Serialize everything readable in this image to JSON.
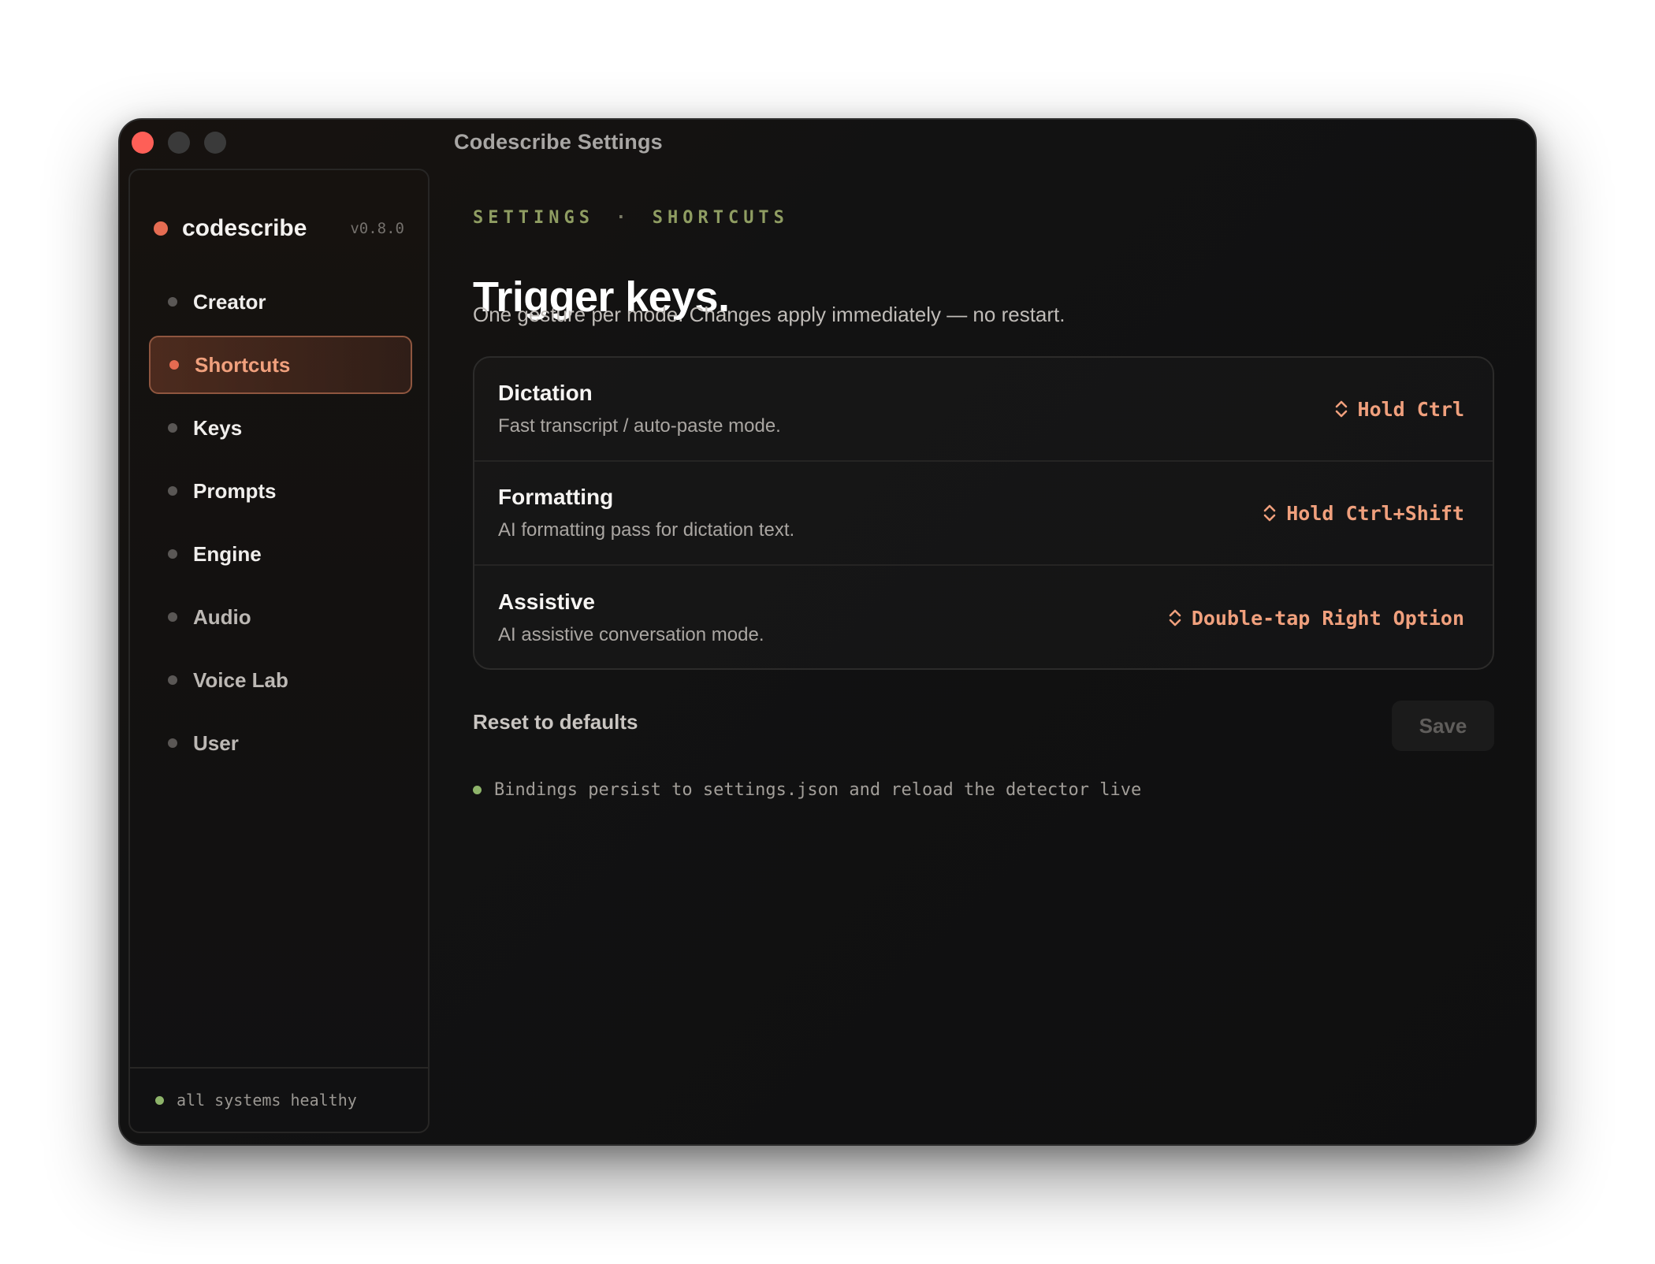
{
  "window": {
    "title": "Codescribe Settings"
  },
  "sidebar": {
    "brand": {
      "name": "codescribe",
      "version": "v0.8.0"
    },
    "items": [
      {
        "label": "Creator"
      },
      {
        "label": "Shortcuts",
        "active": true
      },
      {
        "label": "Keys"
      },
      {
        "label": "Prompts"
      },
      {
        "label": "Engine"
      },
      {
        "label": "Audio"
      },
      {
        "label": "Voice Lab"
      },
      {
        "label": "User"
      }
    ],
    "footer_status": "all systems healthy"
  },
  "main": {
    "breadcrumb": {
      "section": "SETTINGS",
      "separator": "·",
      "page": "SHORTCUTS"
    },
    "title": "Trigger keys.",
    "subtitle": "One gesture per mode. Changes apply immediately — no restart.",
    "bindings": [
      {
        "name": "Dictation",
        "description": "Fast transcript / auto-paste mode.",
        "shortcut": "Hold Ctrl"
      },
      {
        "name": "Formatting",
        "description": "AI formatting pass for dictation text.",
        "shortcut": "Hold Ctrl+Shift"
      },
      {
        "name": "Assistive",
        "description": "AI assistive conversation mode.",
        "shortcut": "Double-tap Right Option"
      }
    ],
    "actions": {
      "reset_label": "Reset to defaults",
      "save_label": "Save"
    },
    "persist_note": "Bindings persist to settings.json and reload the detector live"
  },
  "colors": {
    "accent": "#e66b51",
    "accent_text": "#f0a07d",
    "success": "#8eb46a",
    "background": "#121212"
  },
  "icons": {
    "brand": "status-dot",
    "shortcut_selector": "chevron-up-down-icon"
  }
}
